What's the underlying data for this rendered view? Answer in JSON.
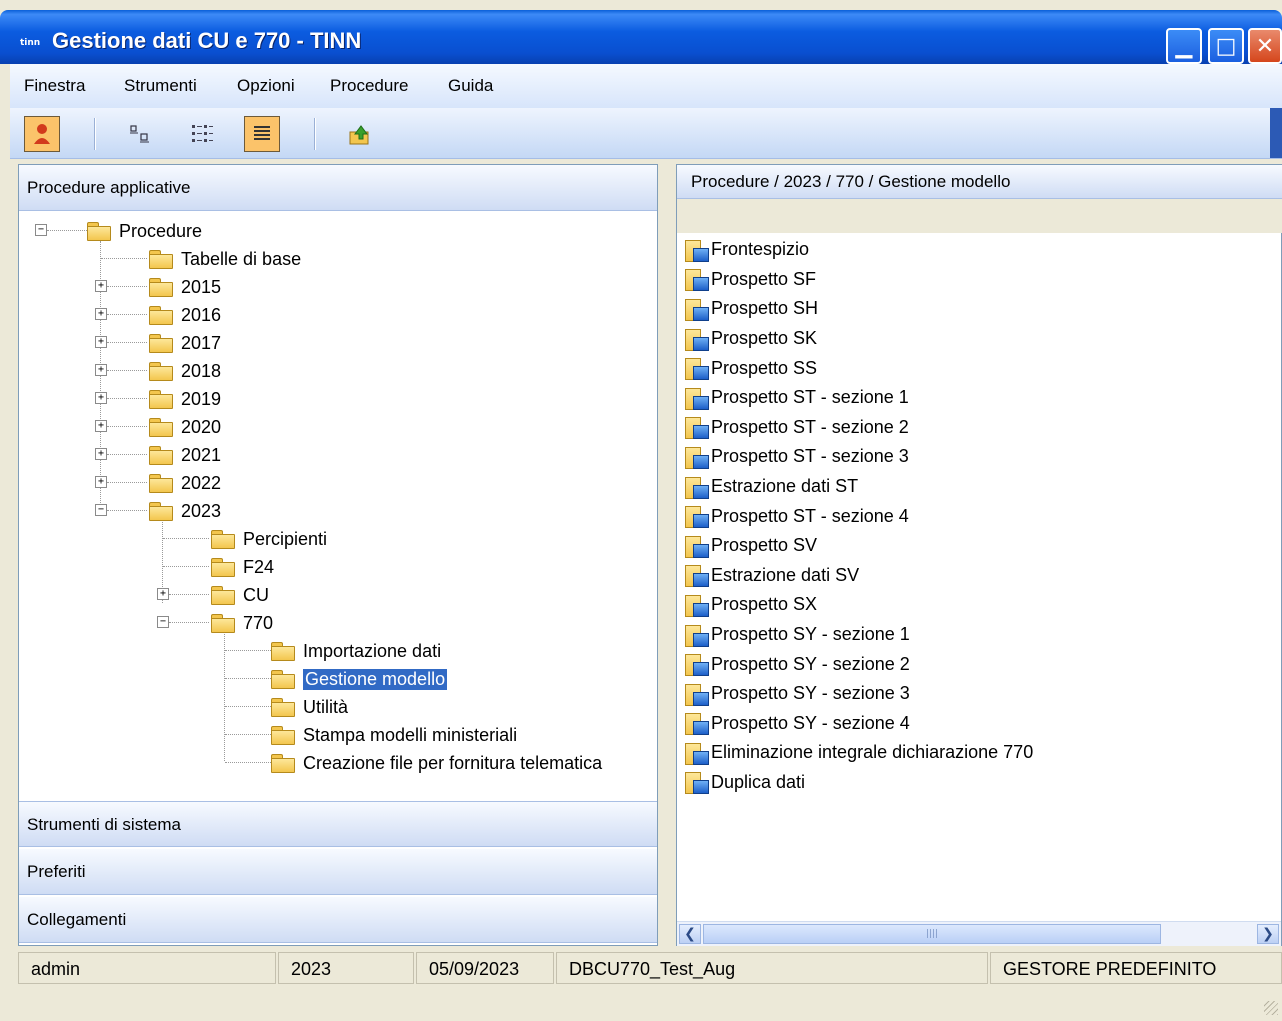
{
  "window": {
    "logo_text": "tinn",
    "title": "Gestione dati CU e 770 - TINN",
    "min_glyph": "▁",
    "max_glyph": "□",
    "close_glyph": "✕"
  },
  "menu": [
    "Finestra",
    "Strumenti",
    "Opzioni",
    "Procedure",
    "Guida"
  ],
  "toolbar": {
    "icons": [
      "user-icon",
      "text-size-icon",
      "list-view-icon",
      "details-view-icon",
      "export-icon"
    ]
  },
  "left_panel": {
    "sections": [
      "Procedure applicative",
      "Strumenti di sistema",
      "Preferiti",
      "Collegamenti"
    ],
    "tree": {
      "root": "Procedure",
      "level1": [
        "Tabelle di base",
        "2015",
        "2016",
        "2017",
        "2018",
        "2019",
        "2020",
        "2021",
        "2022",
        "2023"
      ],
      "year2023_children": [
        "Percipienti",
        "F24",
        "CU",
        "770"
      ],
      "m770_children": [
        "Importazione dati",
        "Gestione modello",
        "Utilità",
        "Stampa modelli ministeriali",
        "Creazione file per fornitura telematica"
      ],
      "selected": "Gestione modello"
    }
  },
  "right_panel": {
    "breadcrumb": "Procedure / 2023 / 770 / Gestione modello",
    "items": [
      "Frontespizio",
      "Prospetto SF",
      "Prospetto SH",
      "Prospetto SK",
      "Prospetto SS",
      "Prospetto ST - sezione 1",
      "Prospetto ST - sezione 2",
      "Prospetto ST - sezione 3",
      "Estrazione dati ST",
      "Prospetto ST - sezione 4",
      "Prospetto SV",
      "Estrazione dati SV",
      "Prospetto SX",
      "Prospetto SY - sezione 1",
      "Prospetto SY - sezione 2",
      "Prospetto SY - sezione 3",
      "Prospetto SY - sezione 4",
      "Eliminazione integrale dichiarazione 770",
      "Duplica dati"
    ]
  },
  "status": {
    "user": "admin",
    "year": "2023",
    "date": "05/09/2023",
    "database": "DBCU770_Test_Aug",
    "manager": "GESTORE PREDEFINITO"
  }
}
